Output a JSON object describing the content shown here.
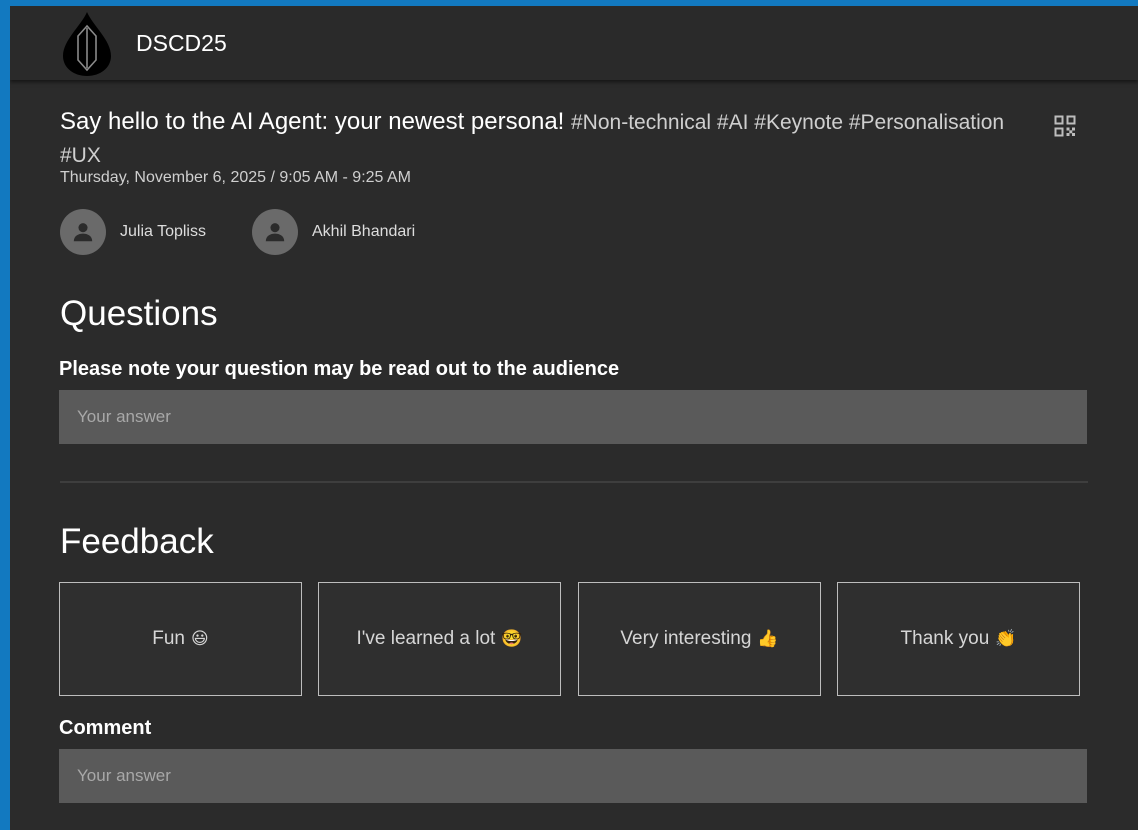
{
  "app": {
    "title": "DSCD25"
  },
  "session": {
    "title": "Say hello to the AI Agent: your newest persona!",
    "tags": "#Non-technical #AI #Keynote #Personalisation #UX",
    "datetime": "Thursday, November 6, 2025 / 9:05 AM - 9:25 AM",
    "speakers": [
      {
        "name": "Julia Topliss",
        "icon": "person-icon"
      },
      {
        "name": "Akhil Bhandari",
        "icon": "person-icon"
      }
    ]
  },
  "questions": {
    "heading": "Questions",
    "label": "Please note your question may be read out to the audience",
    "placeholder": "Your answer",
    "value": ""
  },
  "feedback": {
    "heading": "Feedback",
    "options": [
      {
        "label": "Fun",
        "emoji": "😃"
      },
      {
        "label": "I've learned a lot",
        "emoji": "🤓"
      },
      {
        "label": "Very interesting",
        "emoji": "👍"
      },
      {
        "label": "Thank you",
        "emoji": "👏"
      }
    ],
    "comment_label": "Comment",
    "comment_placeholder": "Your answer",
    "comment_value": ""
  },
  "icons": {
    "logo": "drop-logo-icon",
    "qr": "qr-code-icon",
    "speaker": "person-icon"
  },
  "colors": {
    "background": "#2b2b2b",
    "input": "#5a5a5a",
    "frame": "#1279c0"
  }
}
